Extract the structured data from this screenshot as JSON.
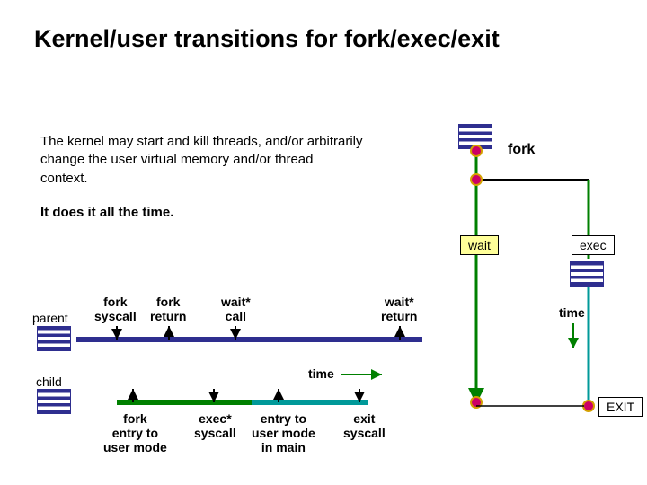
{
  "title": "Kernel/user transitions for fork/exec/exit",
  "description": "The kernel may start and kill threads, and/or arbitrarily change the user virtual memory and/or thread context.",
  "description2": "It does it all the time.",
  "labels": {
    "parent": "parent",
    "child": "child",
    "fork_syscall": "fork\nsyscall",
    "fork_return": "fork\nreturn",
    "wait_call": "wait*\ncall",
    "wait_return": "wait*\nreturn",
    "fork_entry": "fork\nentry to\nuser mode",
    "exec_syscall": "exec*\nsyscall",
    "entry_main": "entry to\nuser mode\nin main",
    "exit_syscall": "exit\nsyscall",
    "time": "time",
    "fork": "fork",
    "wait": "wait",
    "exec": "exec",
    "exit_caps": "EXIT",
    "time2": "time"
  },
  "colors": {
    "darkblue": "#2e2e8f",
    "green": "#008000",
    "teal": "#009999",
    "arrow": "#000000",
    "node_fill": "#cc0066",
    "node_stroke": "#d4a000",
    "wait_bg": "#ffff99"
  }
}
